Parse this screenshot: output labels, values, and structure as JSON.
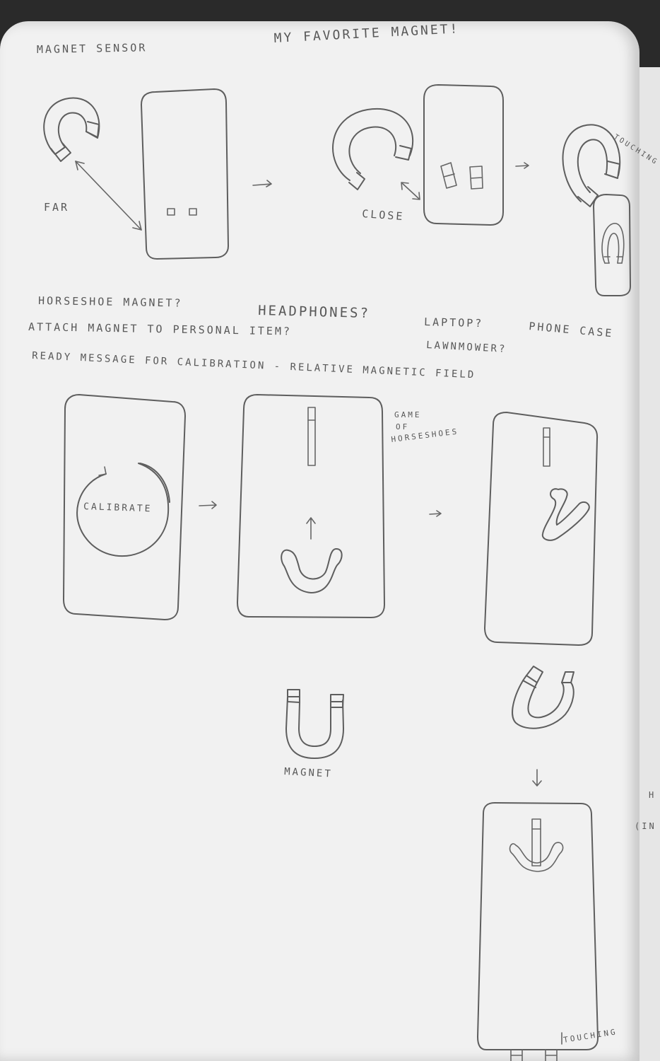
{
  "header": {
    "left_title": "MAGNET SENSOR",
    "right_title": "MY FAVORITE MAGNET!"
  },
  "row1": {
    "far_label": "FAR",
    "close_label": "CLOSE",
    "touching_label": "TOUCHING"
  },
  "notes": {
    "line1_a": "HORSESHOE MAGNET?",
    "line1_b": "HEADPHONES?",
    "line1_c": "LAPTOP?",
    "line1_d": "PHONE CASE",
    "line2_a": "ATTACH MAGNET TO PERSONAL ITEM?",
    "line2_b": "LAWNMOWER?",
    "line3": "READY MESSAGE FOR CALIBRATION - RELATIVE MAGNETIC FIELD"
  },
  "row2": {
    "calibrate_label": "CALIBRATE",
    "game_line1": "GAME",
    "game_line2": "OF",
    "game_line3": "HORSESHOES"
  },
  "row3": {
    "magnet_label": "MAGNET",
    "touching_label": "TOUCHING"
  },
  "margin": {
    "fragment_h": "H",
    "fragment_in": "(IN"
  }
}
